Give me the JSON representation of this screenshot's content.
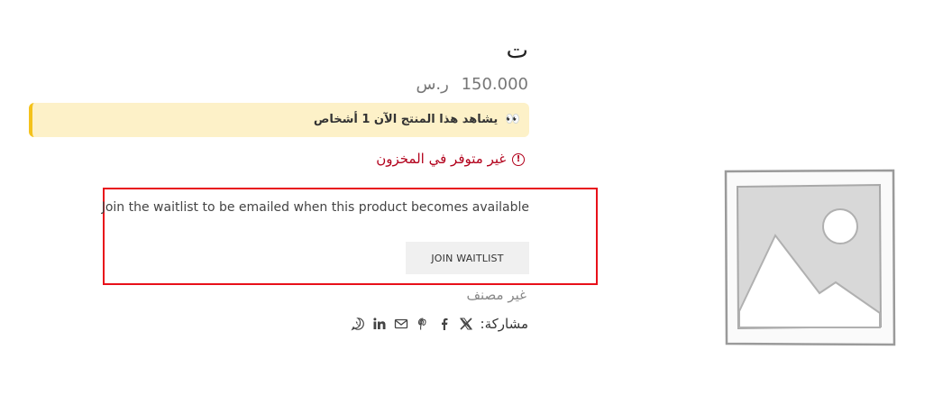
{
  "product": {
    "title": "ت",
    "price_amount": "150.000",
    "price_currency": "ر.س",
    "viewers_text": "يشاهد هذا المنتج الآن 1 أشخاص",
    "stock_status": "غير متوفر في المخزون",
    "category": "غير مصنف"
  },
  "waitlist": {
    "message": "Join the waitlist to be emailed when this product becomes available",
    "button_label": "JOIN WAITLIST"
  },
  "share": {
    "label": "مشاركة:",
    "icons": [
      "x-twitter-icon",
      "facebook-icon",
      "pinterest-icon",
      "email-icon",
      "linkedin-icon",
      "whatsapp-icon"
    ]
  },
  "colors": {
    "notice_bg": "#fdf1c8",
    "notice_border": "#f4c21b",
    "stock_red": "#b2001b",
    "highlight_red": "#e8101a"
  }
}
